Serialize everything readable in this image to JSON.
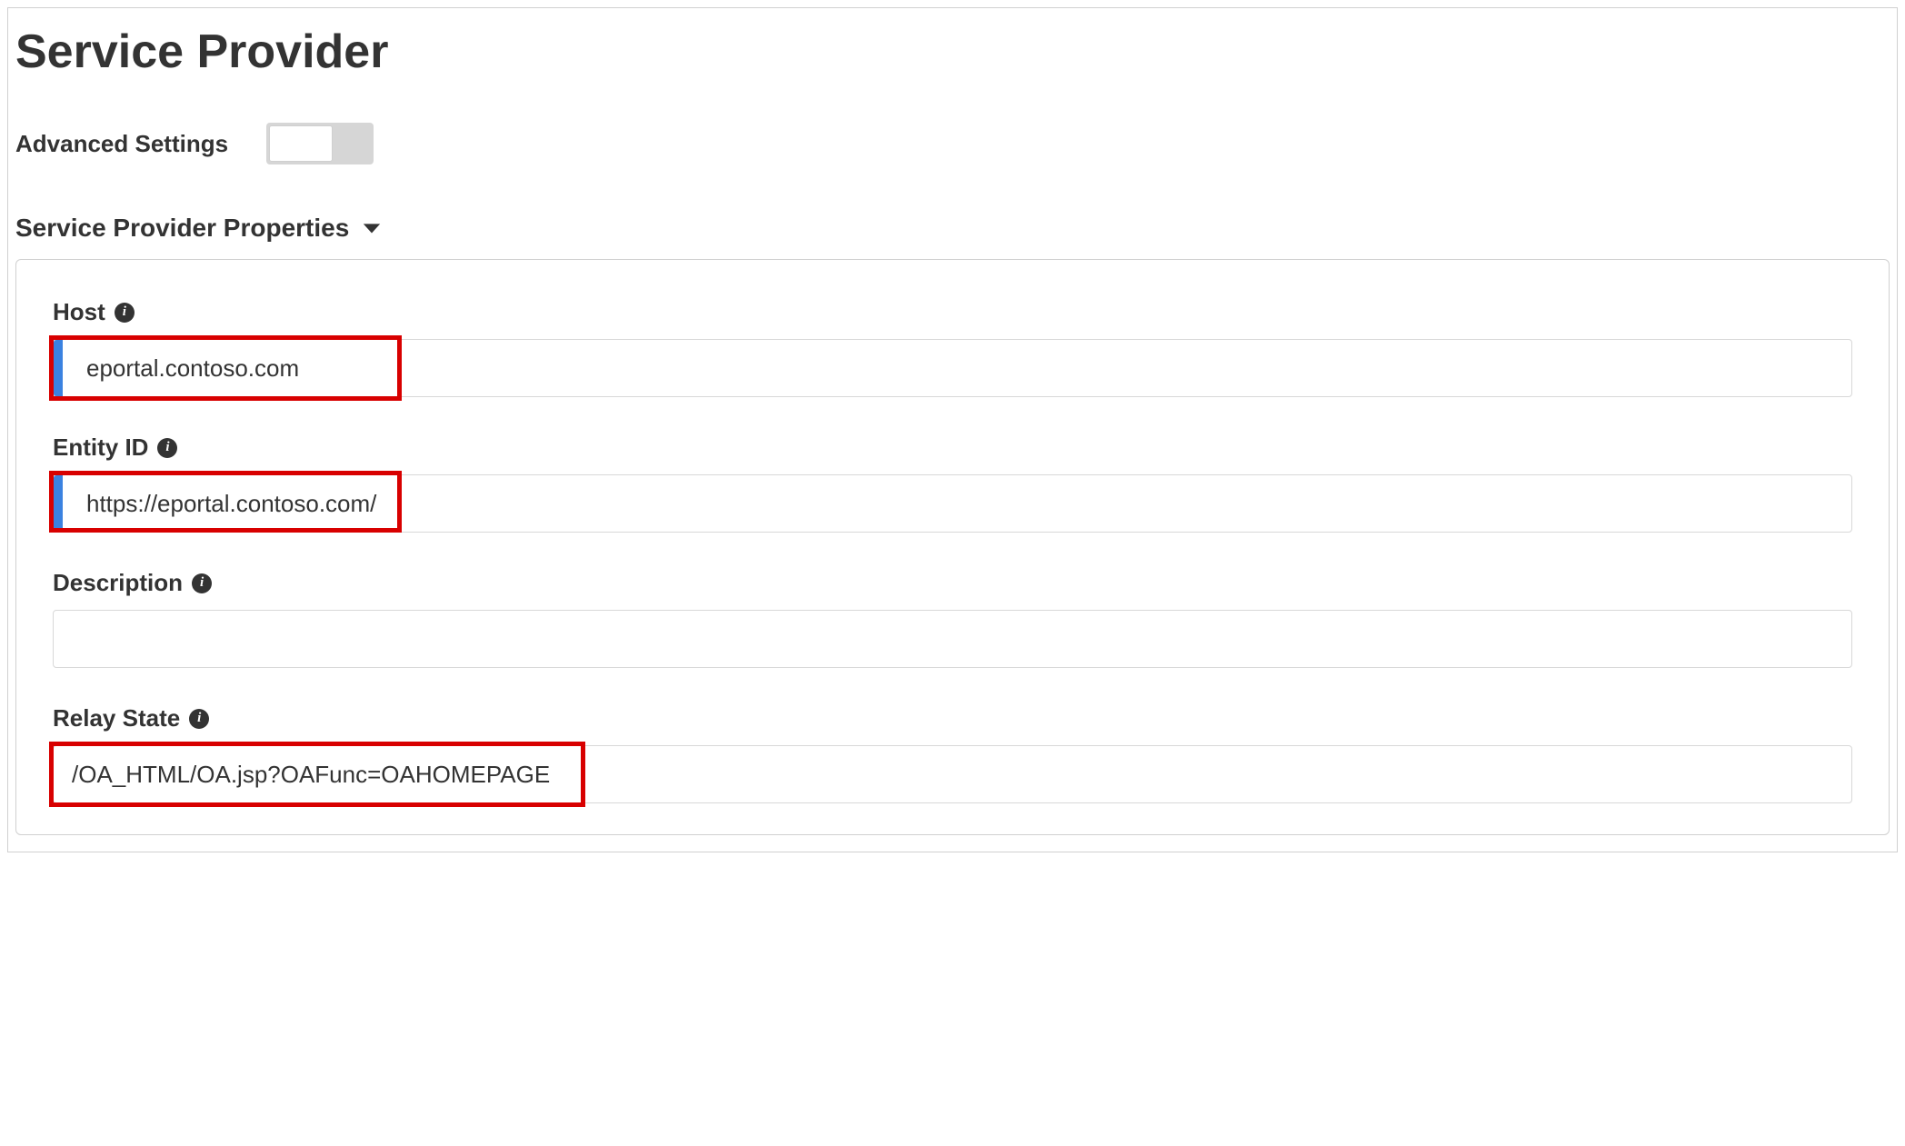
{
  "page": {
    "title": "Service Provider"
  },
  "advanced": {
    "label": "Advanced Settings",
    "toggled": false
  },
  "section": {
    "heading": "Service Provider Properties"
  },
  "fields": {
    "host": {
      "label": "Host",
      "value": "eportal.contoso.com"
    },
    "entity_id": {
      "label": "Entity ID",
      "value": "https://eportal.contoso.com/"
    },
    "description": {
      "label": "Description",
      "value": ""
    },
    "relay_state": {
      "label": "Relay State",
      "value": "/OA_HTML/OA.jsp?OAFunc=OAHOMEPAGE"
    }
  }
}
